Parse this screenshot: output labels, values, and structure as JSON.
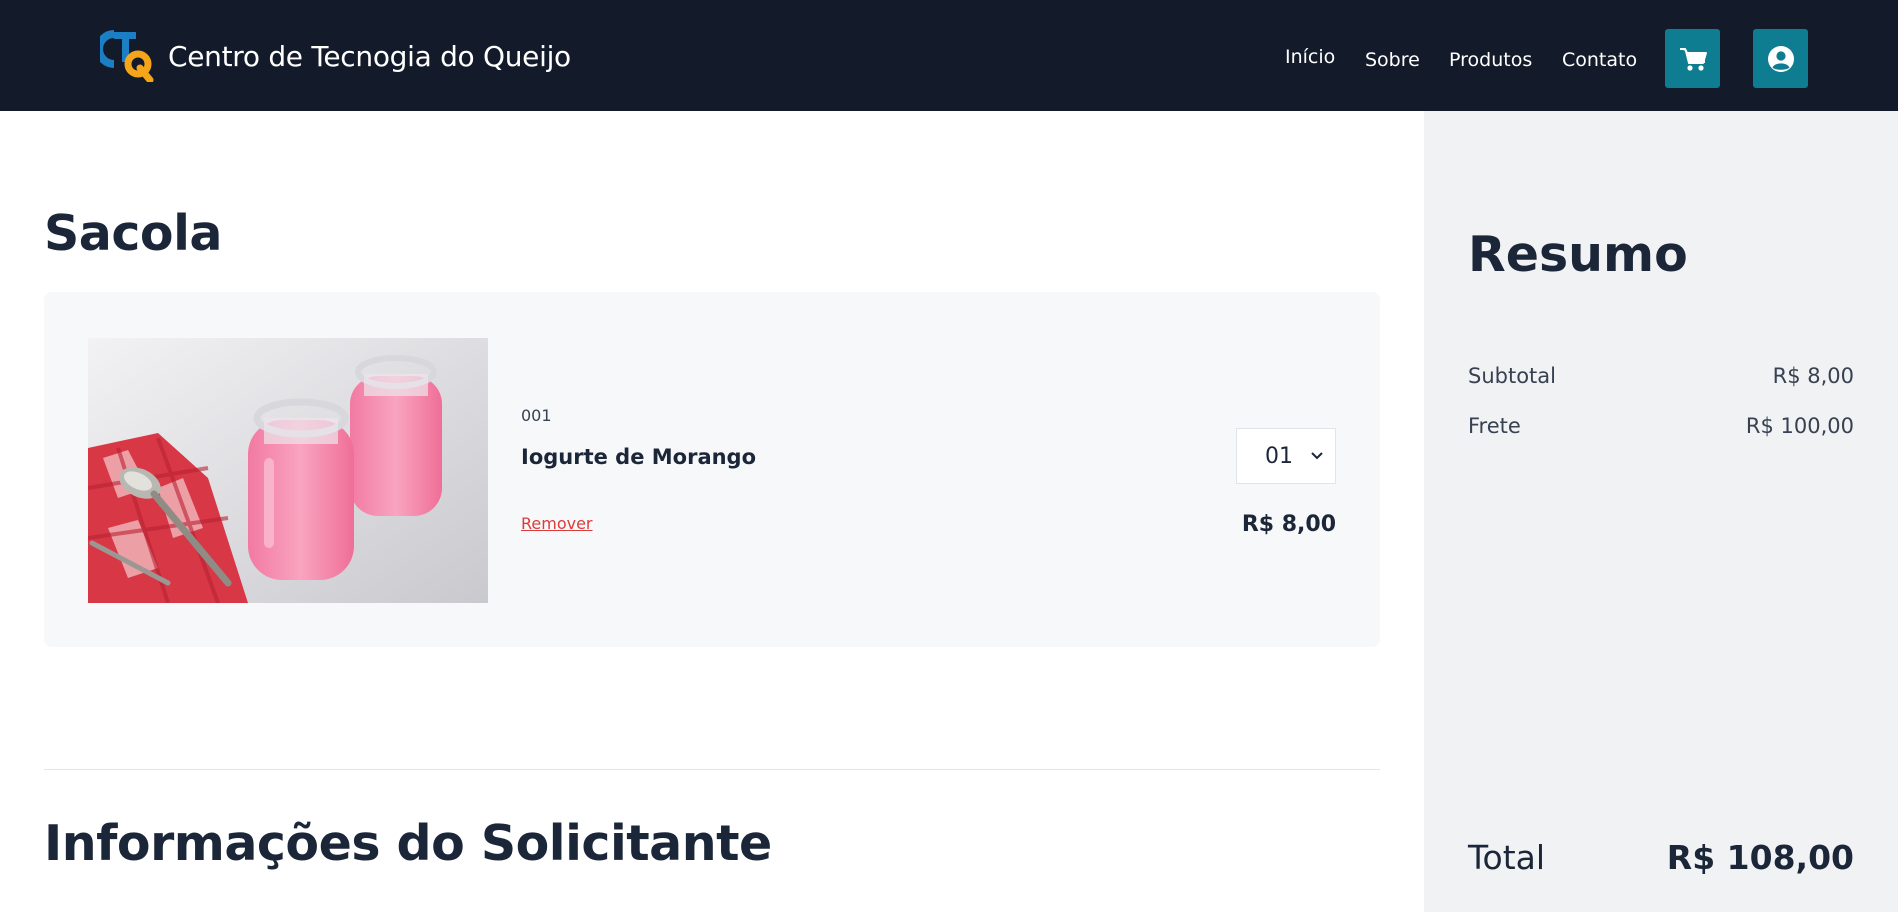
{
  "header": {
    "brand": "Centro de Tecnogia do Queijo",
    "nav": [
      "Início",
      "Sobre",
      "Produtos",
      "Contato"
    ],
    "icons": [
      "cart-icon",
      "user-icon"
    ],
    "colors": {
      "bg": "#131a29",
      "button": "#0e7d92"
    }
  },
  "cart": {
    "title": "Sacola",
    "item": {
      "code": "001",
      "name": "Iogurte de Morango",
      "remove_label": "Remover",
      "quantity": "01",
      "price": "R$ 8,00"
    }
  },
  "requester": {
    "title": "Informações do Solicitante"
  },
  "summary": {
    "title": "Resumo",
    "subtotal_label": "Subtotal",
    "subtotal_value": "R$ 8,00",
    "shipping_label": "Frete",
    "shipping_value": "R$ 100,00",
    "total_label": "Total",
    "total_value": "R$ 108,00"
  }
}
